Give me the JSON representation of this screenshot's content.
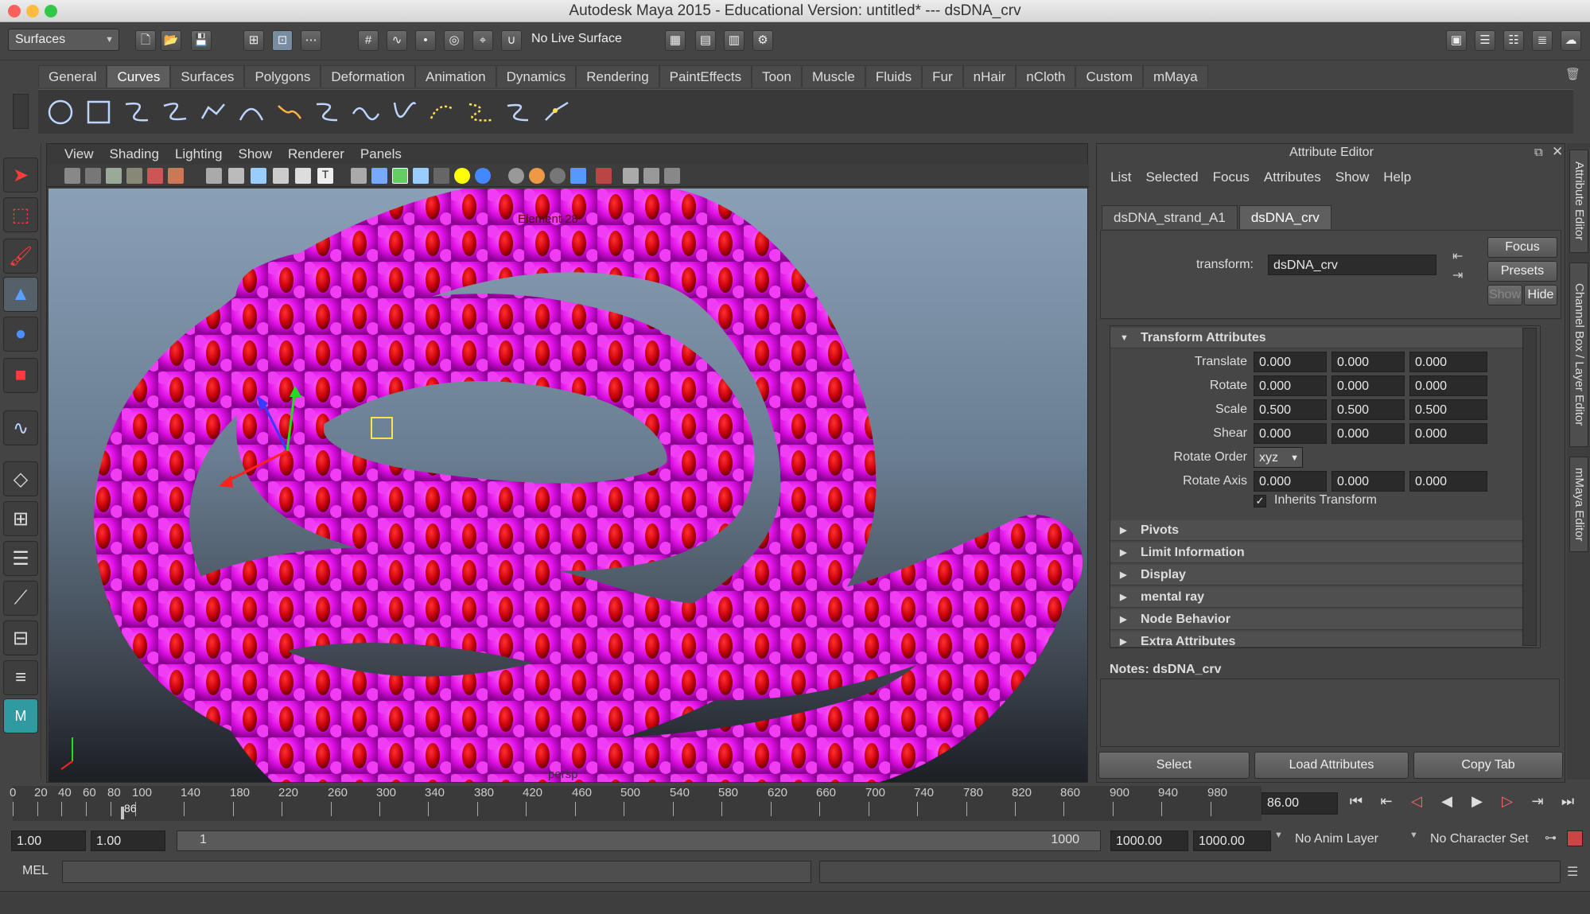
{
  "window": {
    "title": "Autodesk Maya 2015 - Educational Version: untitled*   ---   dsDNA_crv"
  },
  "status_line": {
    "menu_set": "Surfaces",
    "live_surface": "No Live Surface"
  },
  "shelf": {
    "tabs": [
      "General",
      "Curves",
      "Surfaces",
      "Polygons",
      "Deformation",
      "Animation",
      "Dynamics",
      "Rendering",
      "PaintEffects",
      "Toon",
      "Muscle",
      "Fluids",
      "Fur",
      "nHair",
      "nCloth",
      "Custom",
      "mMaya"
    ],
    "active": "Curves"
  },
  "viewport": {
    "menus": [
      "View",
      "Shading",
      "Lighting",
      "Show",
      "Renderer",
      "Panels"
    ],
    "hud_label": "persp",
    "hud_top_label": "Element 28"
  },
  "attribute_editor": {
    "title": "Attribute Editor",
    "menus": [
      "List",
      "Selected",
      "Focus",
      "Attributes",
      "Show",
      "Help"
    ],
    "tabs": [
      "dsDNA_strand_A1",
      "dsDNA_crv"
    ],
    "active_tab": "dsDNA_crv",
    "transform_label": "transform:",
    "transform_value": "dsDNA_crv",
    "buttons": {
      "focus": "Focus",
      "presets": "Presets",
      "show": "Show",
      "hide": "Hide"
    },
    "section_transform": "Transform Attributes",
    "attrs": {
      "translate": {
        "label": "Translate",
        "x": "0.000",
        "y": "0.000",
        "z": "0.000"
      },
      "rotate": {
        "label": "Rotate",
        "x": "0.000",
        "y": "0.000",
        "z": "0.000"
      },
      "scale": {
        "label": "Scale",
        "x": "0.500",
        "y": "0.500",
        "z": "0.500"
      },
      "shear": {
        "label": "Shear",
        "x": "0.000",
        "y": "0.000",
        "z": "0.000"
      },
      "rotate_order": {
        "label": "Rotate Order",
        "value": "xyz"
      },
      "rotate_axis": {
        "label": "Rotate Axis",
        "x": "0.000",
        "y": "0.000",
        "z": "0.000"
      },
      "inherits": {
        "label": "Inherits Transform",
        "checked": true
      }
    },
    "sections": [
      "Pivots",
      "Limit Information",
      "Display",
      "mental ray",
      "Node Behavior",
      "Extra Attributes"
    ],
    "notes_label": "Notes:  dsDNA_crv",
    "bottom_buttons": {
      "select": "Select",
      "load": "Load Attributes",
      "copy": "Copy Tab"
    }
  },
  "side_tabs": [
    "Attribute Editor",
    "Channel Box / Layer Editor",
    "mMaya Editor"
  ],
  "timeline": {
    "ticks": [
      "0",
      "20",
      "40",
      "60",
      "80",
      "100",
      "140",
      "180",
      "220",
      "260",
      "300",
      "340",
      "380",
      "420",
      "460",
      "500",
      "540",
      "580",
      "620",
      "660",
      "700",
      "740",
      "780",
      "820",
      "860",
      "900",
      "940",
      "980"
    ],
    "current_marker": "86",
    "current_frame": "86.00"
  },
  "range": {
    "start": "1.00",
    "playback_start": "1.00",
    "slider_start": "1",
    "slider_end": "1000",
    "playback_end": "1000.00",
    "end": "1000.00",
    "anim_layer": "No Anim Layer",
    "character_set": "No Character Set"
  },
  "command_line": {
    "label": "MEL"
  },
  "colors": {
    "dna_magenta": "#e010e6",
    "dna_red": "#c8000c",
    "accent": "#5d5d5d"
  }
}
